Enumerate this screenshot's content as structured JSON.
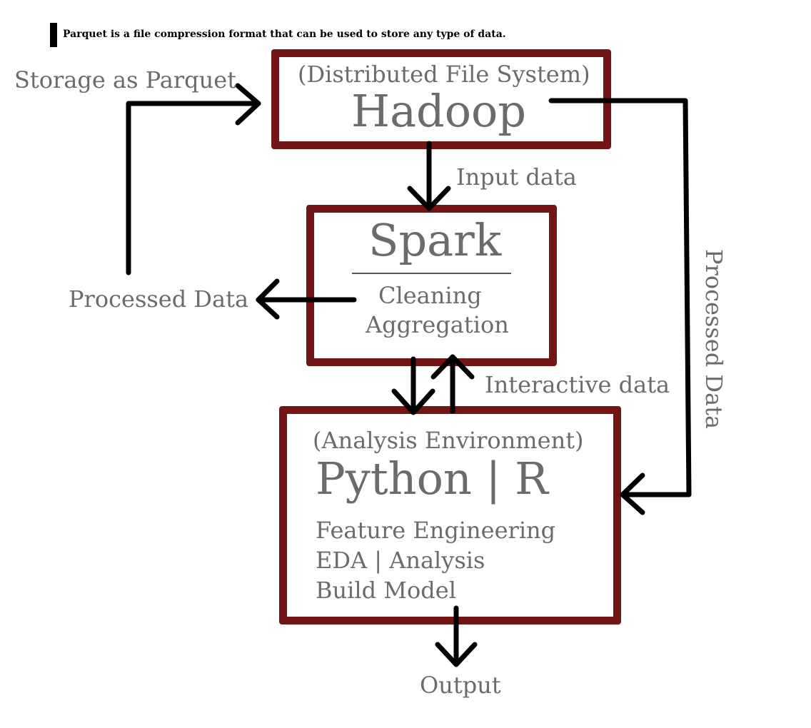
{
  "note": {
    "text": "Parquet is a file compression format that can be used to store any type of data."
  },
  "hadoop": {
    "subtitle": "(Distributed File System)",
    "title": "Hadoop"
  },
  "spark": {
    "title": "Spark",
    "items": [
      "Cleaning",
      "Aggregation"
    ]
  },
  "python": {
    "subtitle": "(Analysis Environment)",
    "title": "Python | R",
    "items": [
      "Feature Engineering",
      "EDA | Analysis",
      "Build Model"
    ]
  },
  "labels": {
    "storage": "Storage as Parquet",
    "input_data": "Input data",
    "processed_left": "Processed Data",
    "processed_right": "Processed Data",
    "interactive": "Interactive data",
    "output": "Output"
  },
  "colors": {
    "box_border": "#731515",
    "text": "#6b6b6b",
    "arrow": "#000000"
  }
}
